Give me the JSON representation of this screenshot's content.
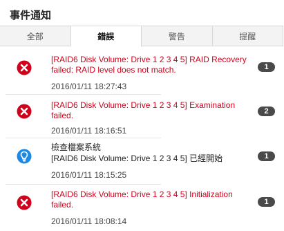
{
  "header": {
    "title": "事件通知"
  },
  "tabs": [
    {
      "label": "全部"
    },
    {
      "label": "錯誤"
    },
    {
      "label": "警告"
    },
    {
      "label": "提醒"
    }
  ],
  "events": [
    {
      "icon": "error-icon",
      "message": "[RAID6 Disk Volume: Drive 1 2 3 4 5] RAID Recovery failed: RAID level does not match.",
      "time": "2016/01/11 18:27:43",
      "count": "1"
    },
    {
      "icon": "error-icon",
      "message": "[RAID6 Disk Volume: Drive 1 2 3 4 5] Examination failed.",
      "time": "2016/01/11 18:16:51",
      "count": "2"
    },
    {
      "icon": "lightbulb-icon",
      "line1": "檢查檔案系統",
      "line2": "[RAID6 Disk Volume: Drive 1 2 3 4 5] 已經開始",
      "time": "2016/01/11 18:15:25",
      "count": "1"
    },
    {
      "icon": "error-icon",
      "message": "[RAID6 Disk Volume: Drive 1 2 3 4 5] Initialization failed.",
      "time": "2016/01/11 18:08:14",
      "count": "1"
    }
  ],
  "colors": {
    "error": "#d0021b",
    "info": "#1e88e5",
    "badge": "#4a4a4a"
  }
}
